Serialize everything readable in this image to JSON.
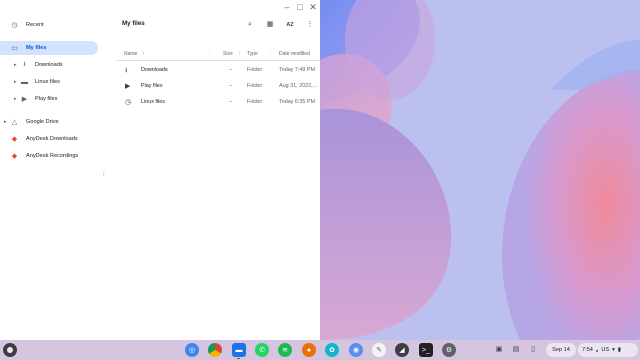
{
  "window": {
    "title": "My files",
    "controls": {
      "minimize": "–",
      "maximize": "□",
      "close": "✕"
    }
  },
  "sidebar": {
    "items": [
      {
        "label": "Recent",
        "icon": "clock-icon",
        "glyph": "◷"
      },
      {
        "label": "My files",
        "icon": "laptop-icon",
        "glyph": "▭"
      },
      {
        "label": "Downloads",
        "icon": "download-icon",
        "glyph": "⭳"
      },
      {
        "label": "Linux files",
        "icon": "folder-icon",
        "glyph": "▬"
      },
      {
        "label": "Play files",
        "icon": "play-icon",
        "glyph": "▶"
      },
      {
        "label": "Google Drive",
        "icon": "drive-icon",
        "glyph": "△"
      },
      {
        "label": "AnyDesk Downloads",
        "icon": "anydesk-icon",
        "glyph": "◆"
      },
      {
        "label": "AnyDesk Recordings",
        "icon": "anydesk-icon",
        "glyph": "◆"
      }
    ]
  },
  "toolbar": {
    "search": "⌕",
    "grid": "▦",
    "sort": "AZ",
    "more": "⋮"
  },
  "table": {
    "headers": {
      "name": "Name",
      "size": "Size",
      "type": "Type",
      "modified": "Date modified"
    },
    "rows": [
      {
        "glyph": "⭳",
        "name": "Downloads",
        "size": "–",
        "type": "Folder",
        "modified": "Today 7:49 PM"
      },
      {
        "glyph": "▶",
        "name": "Play files",
        "size": "–",
        "type": "Folder",
        "modified": "Aug 31, 2022,..."
      },
      {
        "glyph": "◷",
        "name": "Linux files",
        "size": "–",
        "type": "Folder",
        "modified": "Today 6:35 PM"
      }
    ]
  },
  "shelf": {
    "apps": [
      {
        "name": "files-app",
        "color": "#4285f4"
      },
      {
        "name": "chrome-app",
        "color": "#db4437"
      },
      {
        "name": "files-folder-app",
        "color": "#1a73e8"
      },
      {
        "name": "whatsapp-app",
        "color": "#25d366"
      },
      {
        "name": "spotify-app",
        "color": "#1db954"
      },
      {
        "name": "app-orange",
        "color": "#e8710a"
      },
      {
        "name": "app-teal",
        "color": "#12b5cb"
      },
      {
        "name": "app-blue",
        "color": "#5b8ef0"
      },
      {
        "name": "app-white",
        "color": "#f1f3f4"
      },
      {
        "name": "app-black",
        "color": "#3c4043"
      },
      {
        "name": "terminal-app",
        "color": "#202124"
      },
      {
        "name": "settings-app",
        "color": "#5f6368"
      }
    ],
    "date": "Sep 14",
    "time": "7:54",
    "keyboard": "US"
  }
}
